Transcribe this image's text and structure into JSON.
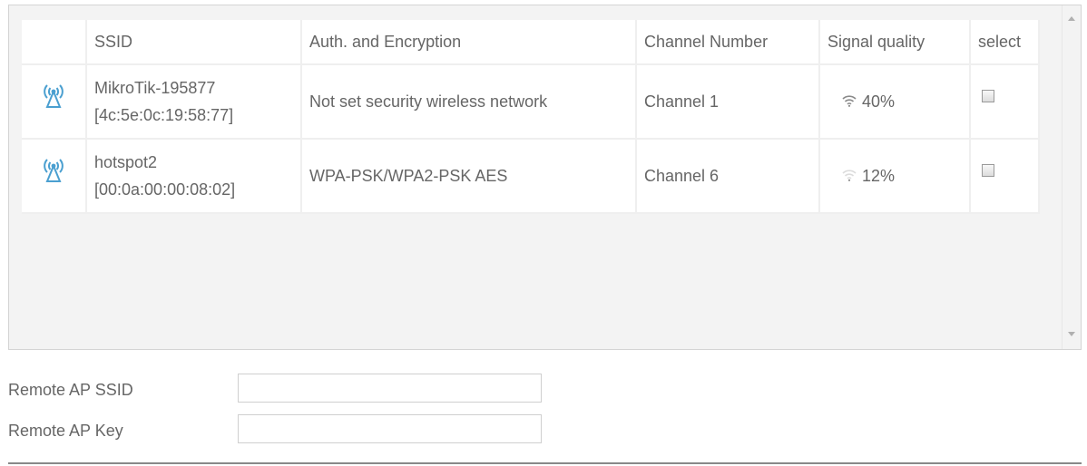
{
  "table": {
    "headers": {
      "ssid": "SSID",
      "auth": "Auth. and Encryption",
      "channel": "Channel Number",
      "signal": "Signal quality",
      "select": "select"
    },
    "rows": [
      {
        "ssid": "MikroTik-195877",
        "mac": "[4c:5e:0c:19:58:77]",
        "auth": "Not set security wireless network",
        "channel": "Channel 1",
        "signal": "40%",
        "signal_fraction": 0.4,
        "selected": false
      },
      {
        "ssid": "hotspot2",
        "mac": "[00:0a:00:00:08:02]",
        "auth": "WPA-PSK/WPA2-PSK AES",
        "channel": "Channel 6",
        "signal": "12%",
        "signal_fraction": 0.12,
        "selected": false
      }
    ]
  },
  "form": {
    "ssid_label": "Remote AP SSID",
    "ssid_value": "",
    "key_label": "Remote AP Key",
    "key_value": ""
  },
  "icons": {
    "ap": "access-point-icon",
    "signal": "wifi-signal-icon"
  },
  "colors": {
    "ap_icon": "#4a9fd0",
    "signal_on": "#8a8a8a",
    "signal_off": "#dcdcdc"
  }
}
